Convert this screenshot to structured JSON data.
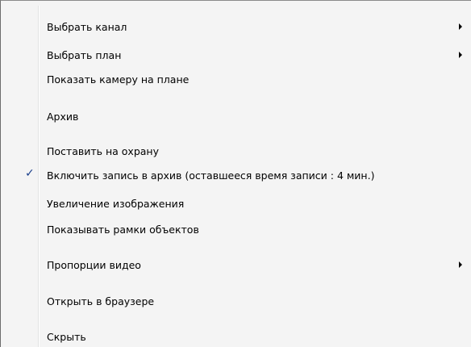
{
  "context_menu": {
    "items": [
      {
        "label": "Выбрать канал",
        "submenu": true
      },
      {
        "label": "Выбрать план",
        "submenu": true
      },
      {
        "label": "Показать камеру на плане"
      },
      {
        "label": "Архив"
      },
      {
        "label": "Поставить на охрану"
      },
      {
        "label": "Включить запись в архив (оставшееся время записи : 4 мин.)",
        "checked": true
      },
      {
        "label": "Увеличение изображения"
      },
      {
        "label": "Показывать рамки объектов"
      },
      {
        "label": "Пропорции видео",
        "submenu": true
      },
      {
        "label": "Открыть в браузере"
      },
      {
        "label": "Скрыть"
      }
    ],
    "check_glyph": "✓"
  }
}
